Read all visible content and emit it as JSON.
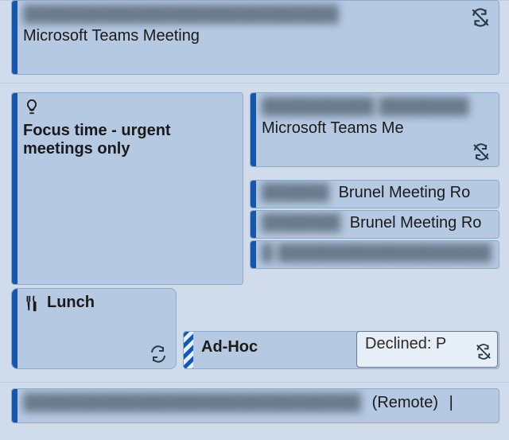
{
  "events": {
    "teams_meeting_top": {
      "subject_obscured": "████████████████████████████",
      "location": "Microsoft Teams Meeting"
    },
    "focus_time": {
      "title": "Focus time - urgent meetings only"
    },
    "teams_meeting_right": {
      "subject_obscured": "██████████ ████████",
      "location": "Microsoft Teams Me"
    },
    "brunel_1": {
      "subject_obscured": "██████",
      "location": "Brunel Meeting Ro"
    },
    "brunel_2": {
      "subject_obscured": "███████",
      "location": "Brunel Meeting Ro"
    },
    "obscured_row": {
      "subject_obscured": "█ ███████████████████"
    },
    "lunch": {
      "title": "Lunch"
    },
    "adhoc": {
      "title": "Ad-Hoc"
    },
    "declined": {
      "label": "Declined: P"
    },
    "remote": {
      "subject_obscured": "██████████████████████████████",
      "suffix": "(Remote)"
    }
  },
  "icons": {
    "lightbulb": "lightbulb-icon",
    "fork_knife": "fork-knife-icon",
    "recur": "recur-icon",
    "no_recur": "no-recur-icon"
  }
}
